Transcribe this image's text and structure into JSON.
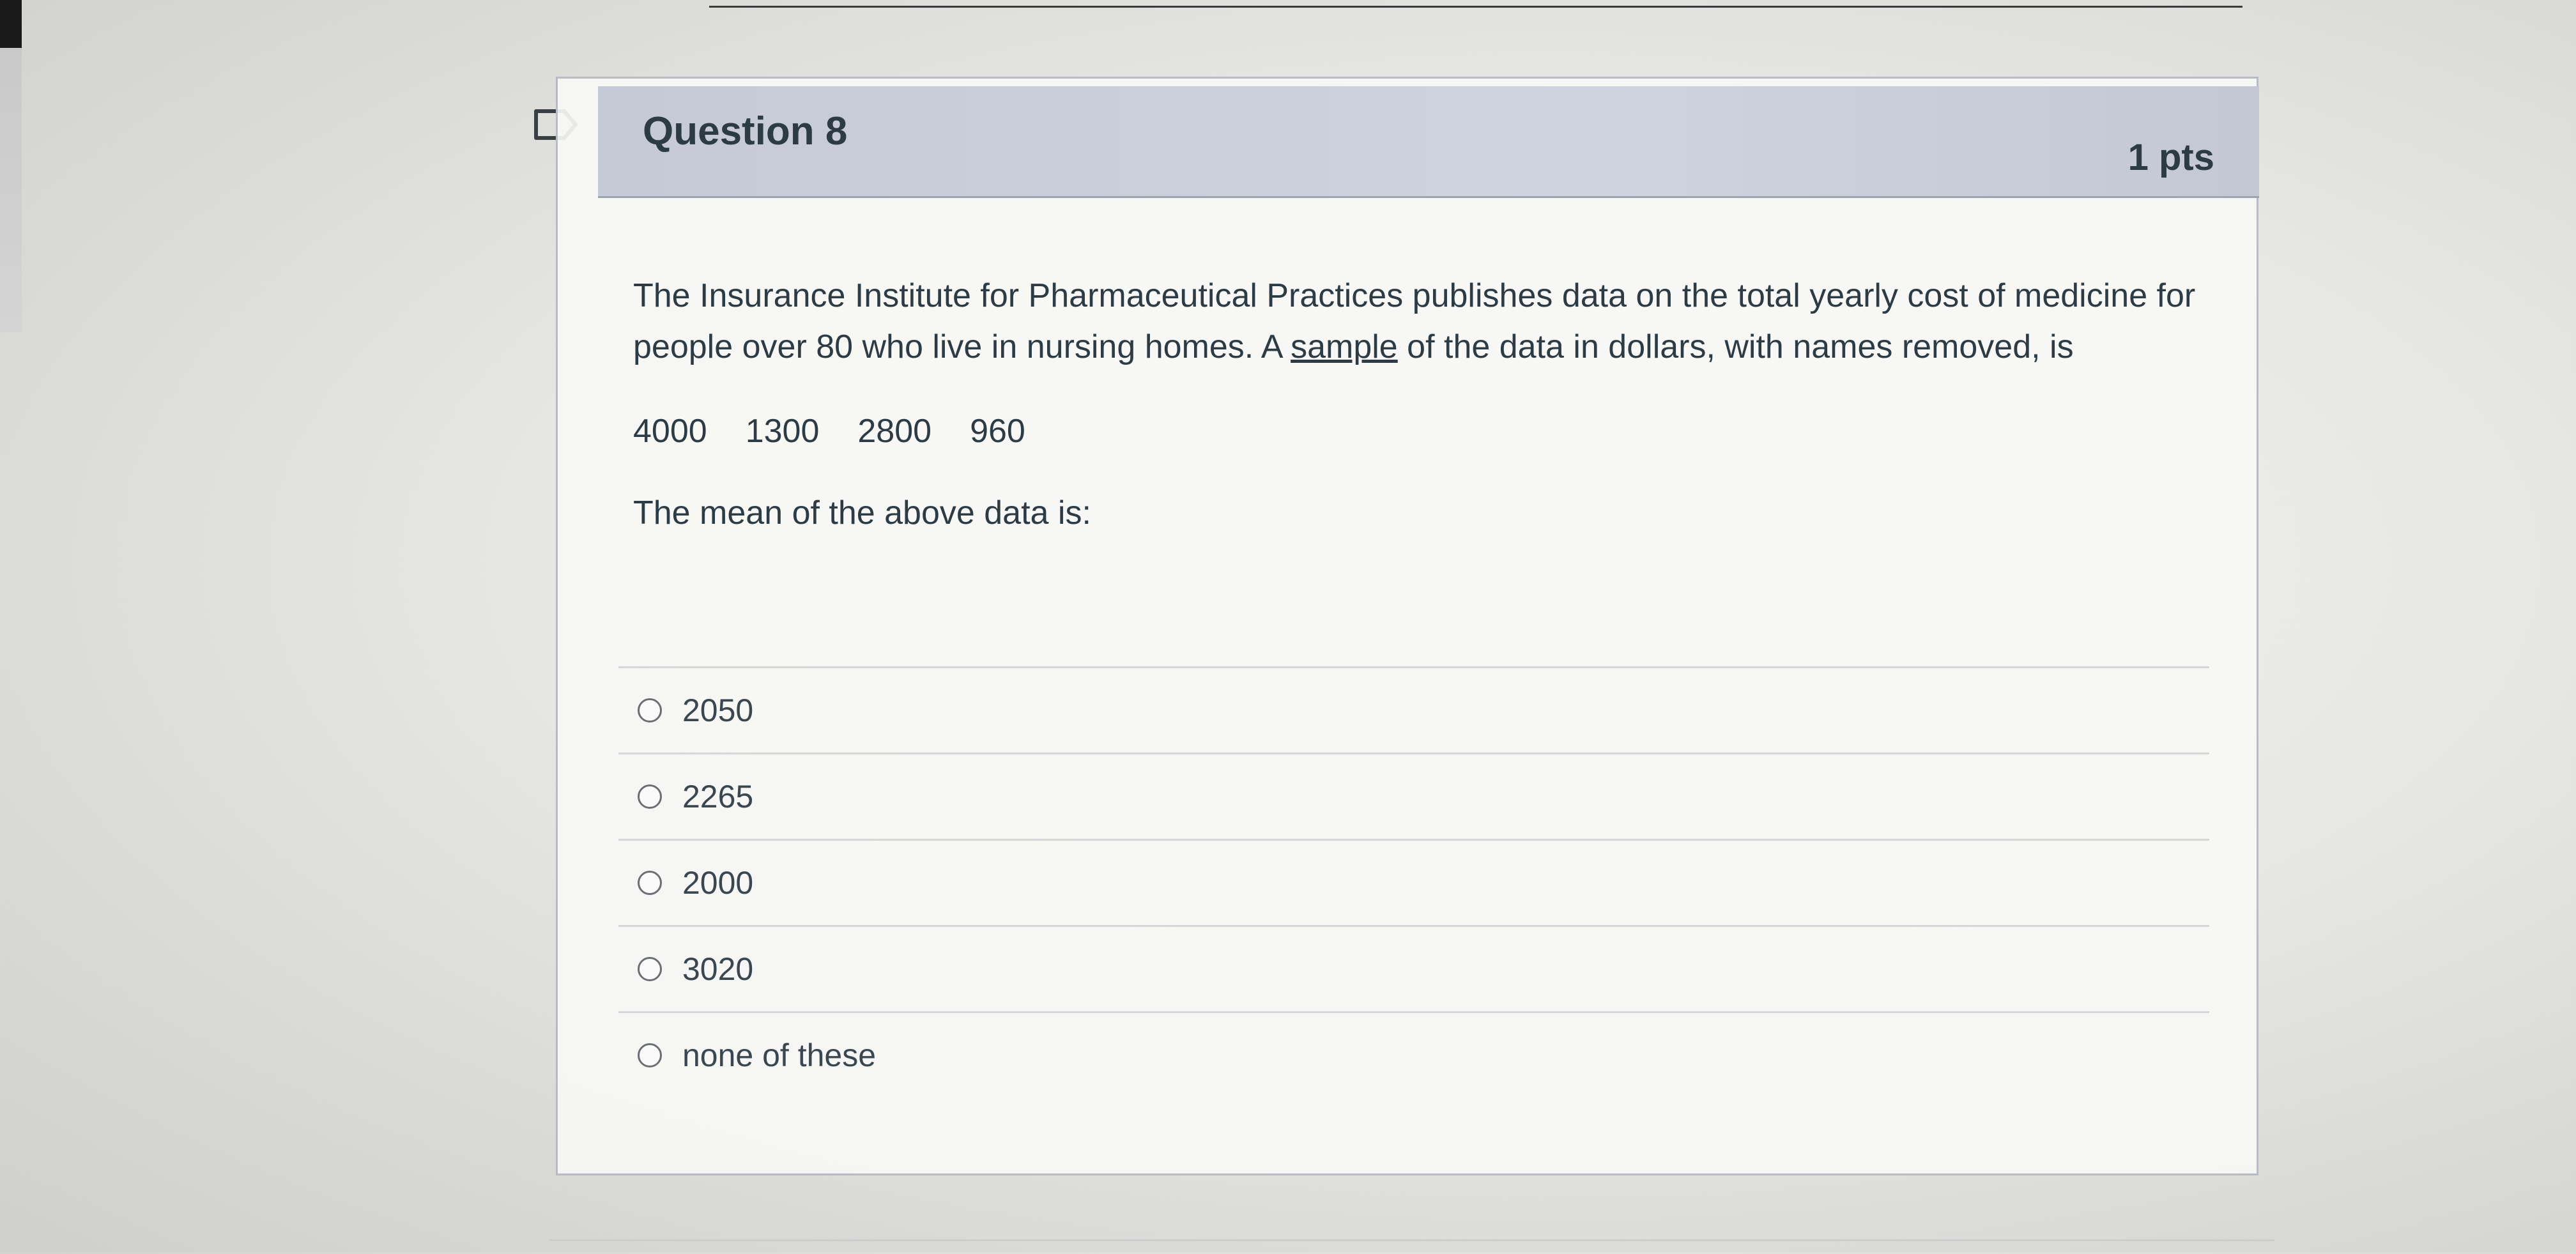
{
  "question": {
    "title": "Question 8",
    "points": "1 pts",
    "prompt_before_link": "The Insurance Institute for Pharmaceutical Practices publishes data on the total yearly cost of medicine for people over 80 who live in nursing homes. A ",
    "prompt_underlined": "sample",
    "prompt_after_link": " of the data in dollars, with names removed, is",
    "data_values": [
      "4000",
      "1300",
      "2800",
      "960"
    ],
    "mean_question": "The mean of the above data is:"
  },
  "answers": [
    {
      "label": "2050",
      "selected": false
    },
    {
      "label": "2265",
      "selected": false
    },
    {
      "label": "2000",
      "selected": false
    },
    {
      "label": "3020",
      "selected": false
    },
    {
      "label": "none of these",
      "selected": false
    }
  ],
  "icons": {
    "flag": "flag-question-icon",
    "radio": "radio-button-icon"
  }
}
